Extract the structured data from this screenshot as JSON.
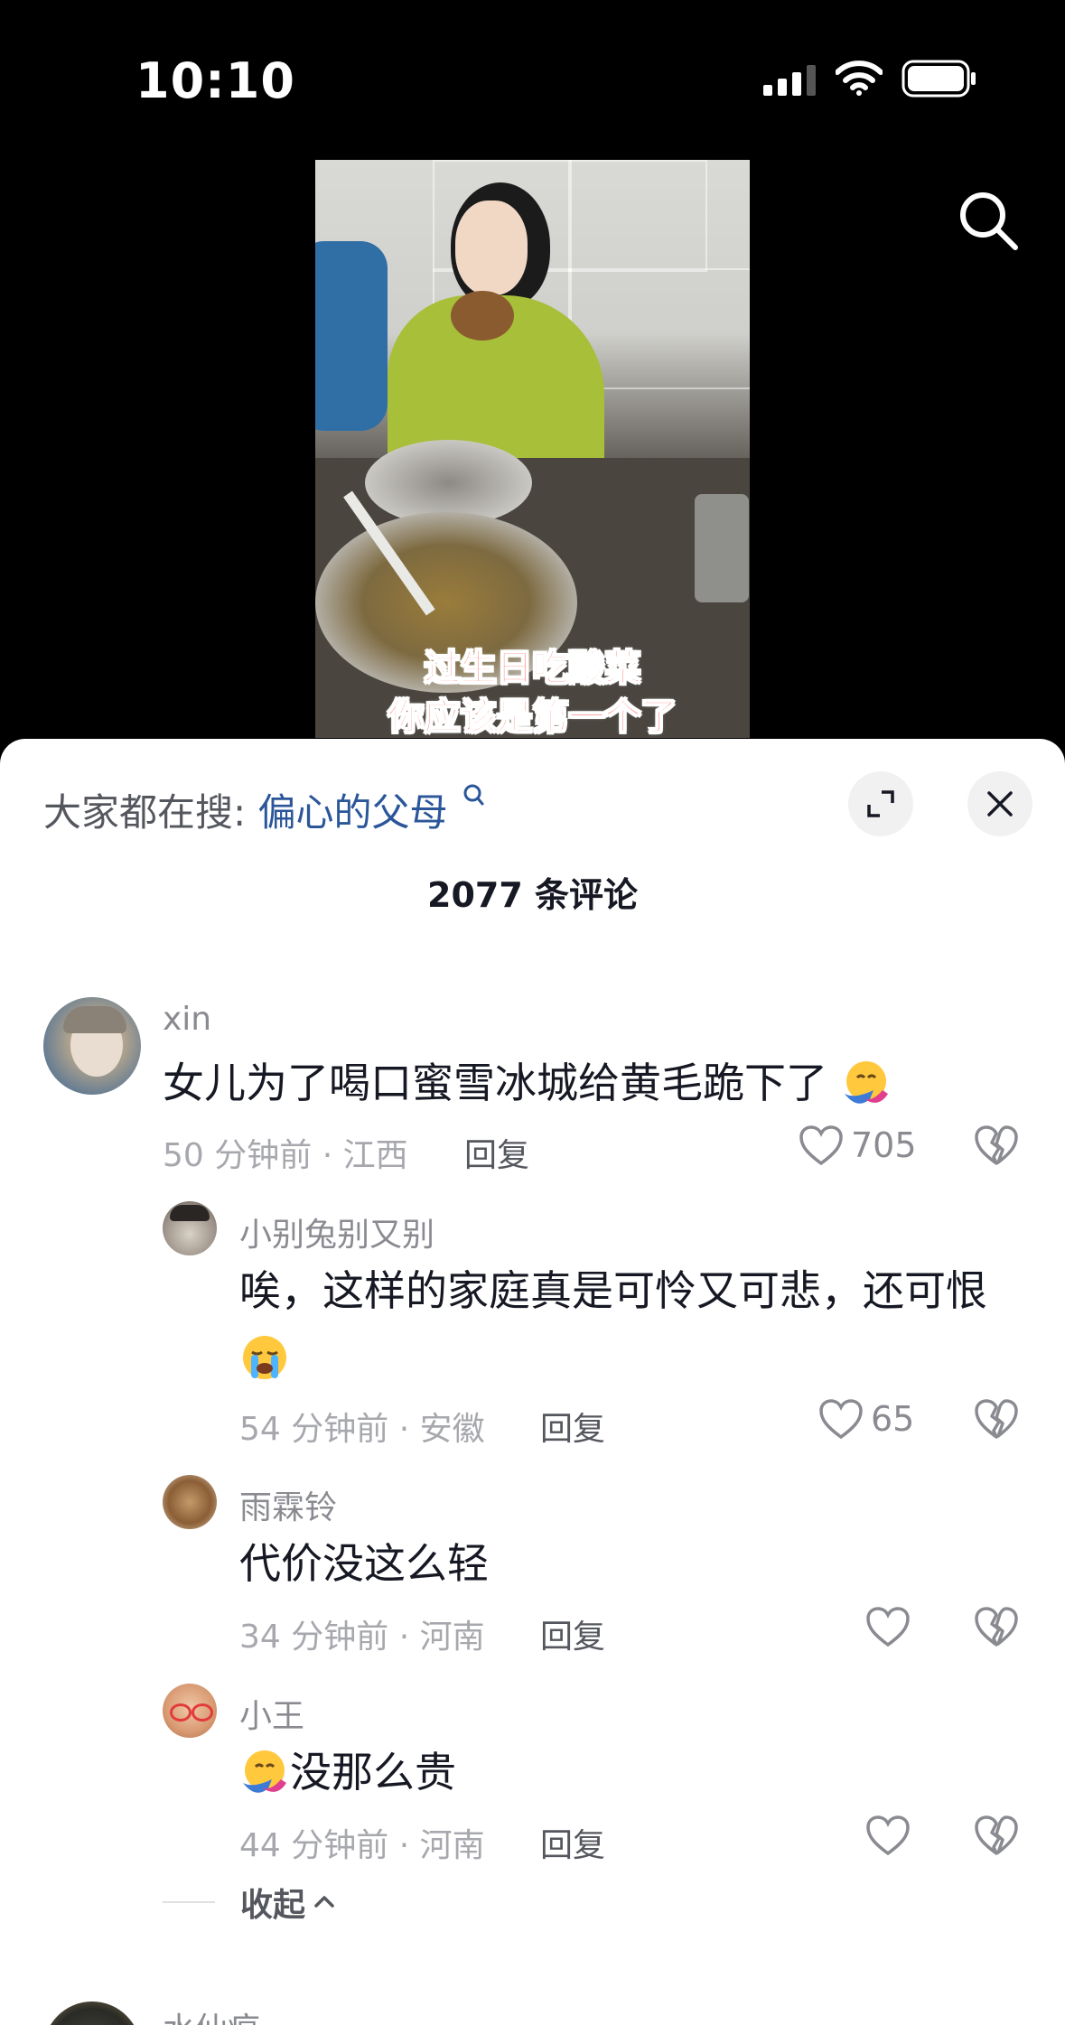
{
  "status": {
    "time": "10:10"
  },
  "video": {
    "caption_line1": "过生日吃酸菜",
    "caption_line2": "你应该是第一个了"
  },
  "sheet": {
    "hot_search_prefix": "大家都在搜:",
    "hot_search_keyword": "偏心的父母",
    "comment_count_title": "2077 条评论",
    "reply_label": "回复",
    "collapse_label": "收起",
    "comments": [
      {
        "user": "xin",
        "text": "女儿为了喝口蜜雪冰城给黄毛跪下了",
        "meta": "50 分钟前 · 江西",
        "likes": "705"
      },
      {
        "user": "小别兔别又别",
        "text": "唉，这样的家庭真是可怜又可悲，还可恨",
        "meta": "54 分钟前 · 安徽",
        "likes": "65"
      },
      {
        "user": "雨霖铃",
        "text": "代价没这么轻",
        "meta": "34 分钟前 · 河南",
        "likes": ""
      },
      {
        "user": "小王",
        "text": "没那么贵",
        "meta": "44 分钟前 · 河南",
        "likes": ""
      },
      {
        "user": "水仙痕"
      }
    ]
  },
  "icons": {
    "emoji_hug": "hugging-face-emoji",
    "emoji_cry": "loudly-crying-face-emoji"
  }
}
